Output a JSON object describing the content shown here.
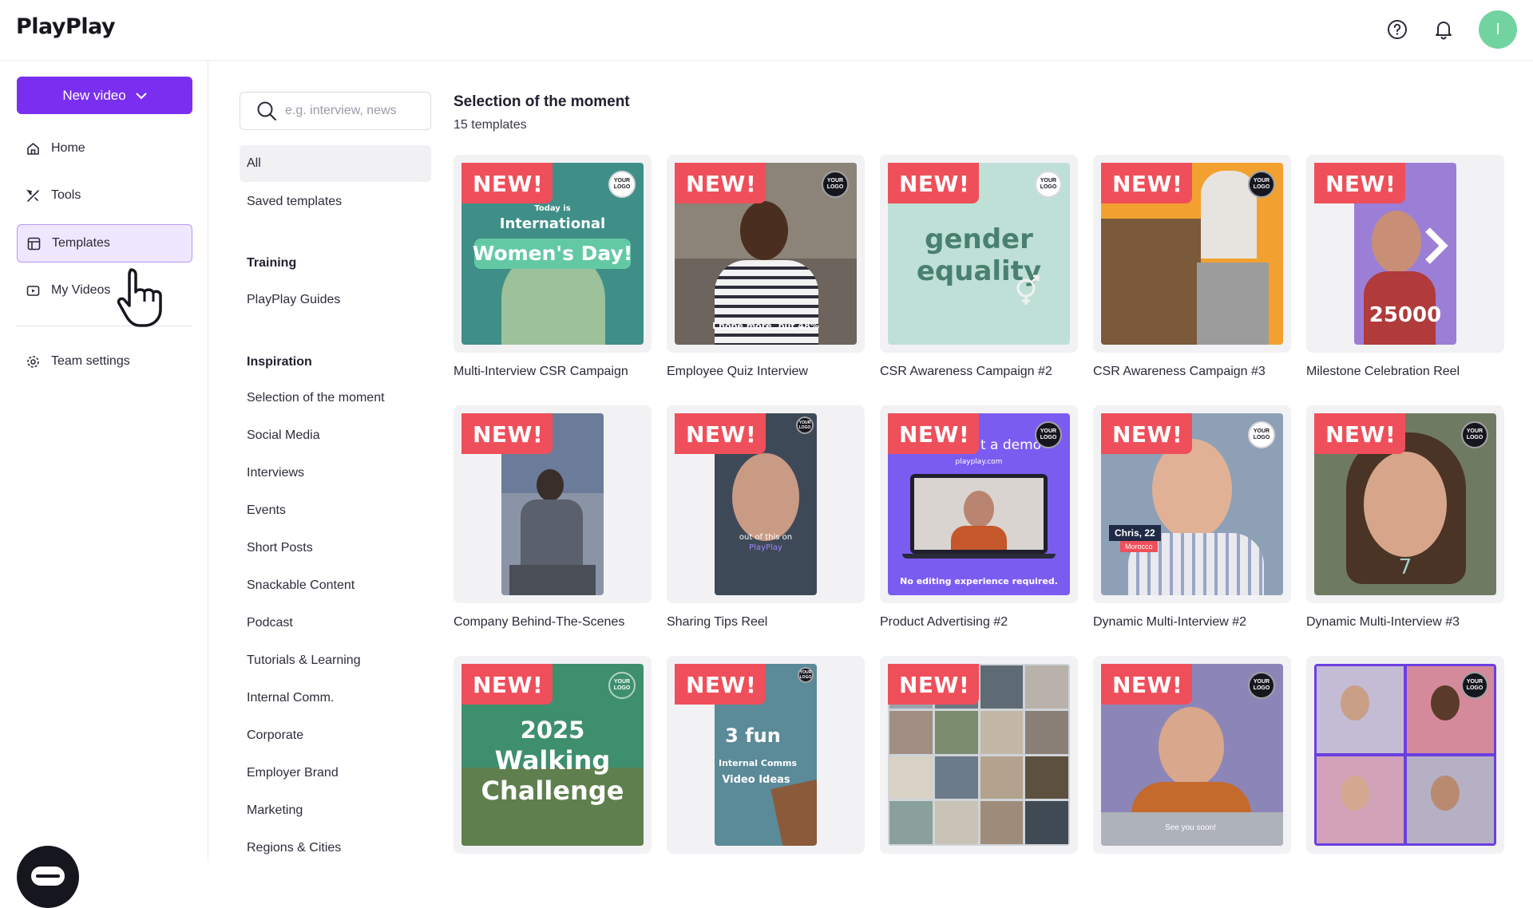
{
  "app": {
    "logo": "PlayPlay",
    "avatar_initial": "I"
  },
  "leftnav": {
    "new_video_label": "New video",
    "items": [
      {
        "label": "Home",
        "icon": "home-icon"
      },
      {
        "label": "Tools",
        "icon": "tools-icon"
      },
      {
        "label": "Templates",
        "icon": "templates-icon",
        "active": true
      },
      {
        "label": "My Videos",
        "icon": "my-videos-icon"
      }
    ],
    "team_settings_label": "Team settings"
  },
  "categories": {
    "search_placeholder": "e.g. interview, news",
    "all_label": "All",
    "saved_label": "Saved templates",
    "training_heading": "Training",
    "training_items": [
      "PlayPlay Guides"
    ],
    "inspiration_heading": "Inspiration",
    "inspiration_items": [
      "Selection of the moment",
      "Social Media",
      "Interviews",
      "Events",
      "Short Posts",
      "Snackable Content",
      "Podcast",
      "Tutorials & Learning",
      "Internal Comm.",
      "Corporate",
      "Employer Brand",
      "Marketing",
      "Regions & Cities"
    ]
  },
  "main": {
    "title": "Selection of the moment",
    "count": "15 templates",
    "badge_text": "NEW!",
    "your_logo_text": "YOUR LOGO",
    "cards": [
      {
        "title": "Multi-Interview CSR Campaign",
        "bg": "#3f8f88",
        "line1": "Today is",
        "line2": "International",
        "line3": "Women's Day!"
      },
      {
        "title": "Employee Quiz Interview",
        "bg": "#6d655d",
        "caption": "I hope more, but 48%"
      },
      {
        "title": "CSR Awareness Campaign #2",
        "bg": "#bfe0d6",
        "line1": "gender",
        "line2": "equality"
      },
      {
        "title": "CSR Awareness Campaign #3",
        "bg": "#f2a130"
      },
      {
        "title": "Milestone Celebration Reel",
        "bg": "#9b7fd6",
        "number": "25000"
      },
      {
        "title": "Company Behind-The-Scenes",
        "bg": "#8a94a6"
      },
      {
        "title": "Sharing Tips Reel",
        "bg": "#3e4957",
        "caption": "out of this on",
        "caption2": "PlayPlay"
      },
      {
        "title": "Product Advertising #2",
        "bg": "#7b5cf0",
        "top_text": "t a demo",
        "site": "playplay.com",
        "footer": "No editing experience required."
      },
      {
        "title": "Dynamic Multi-Interview #2",
        "bg": "#8da0b6",
        "name_tag": "Chris, 22",
        "place_tag": "Morocco"
      },
      {
        "title": "Dynamic Multi-Interview #3",
        "bg": "#6f7a62",
        "number": "7"
      },
      {
        "title": "",
        "bg": "#3e8f6e",
        "line1": "2025",
        "line2": "Walking",
        "line3": "Challenge"
      },
      {
        "title": "",
        "bg": "#5b8a98",
        "line1": "3 fun",
        "line2": "Internal Comms",
        "line3": "Video Ideas"
      },
      {
        "title": "",
        "bg": "#cfd3d8"
      },
      {
        "title": "",
        "bg": "#8c86b8",
        "caption": "See you soon!"
      },
      {
        "title": "",
        "bg": "#6a3fe0"
      }
    ]
  }
}
